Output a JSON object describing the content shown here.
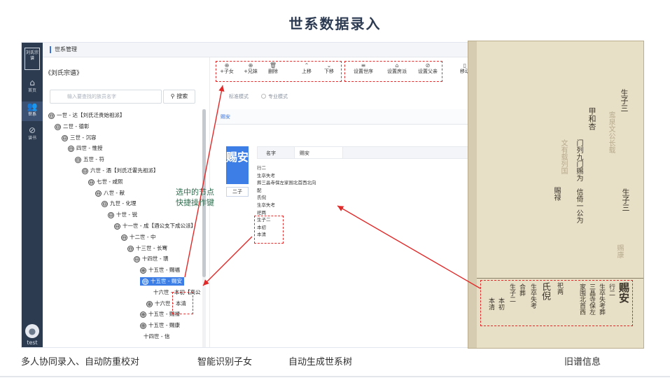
{
  "slide": {
    "title": "世系数据录入",
    "captions": [
      "多人协同录入、自动防重校对",
      "智能识别子女",
      "自动生成世系树",
      "旧谱信息"
    ]
  },
  "app": {
    "logo_text": "刘氏宗谱",
    "nav": [
      {
        "label": "首页",
        "icon": "home-icon"
      },
      {
        "label": "世系",
        "icon": "users-icon"
      },
      {
        "label": "谱书",
        "icon": "book-icon"
      }
    ],
    "user": "test",
    "topbar_title": "世系管理",
    "genealogy_name": "《刘氏宗谱》",
    "search": {
      "placeholder": "输入要查找的族员名字",
      "button": "搜索"
    },
    "tree": [
      {
        "label": "一世 - 达【刘氏迁贵始祖派】",
        "toggle": "⊖"
      },
      {
        "label": "二世 - 德彰",
        "toggle": "⊖"
      },
      {
        "label": "三世 - 沉容",
        "toggle": "⊖"
      },
      {
        "label": "四世 - 惟授",
        "toggle": "⊖"
      },
      {
        "label": "五世 - 符",
        "toggle": "⊖"
      },
      {
        "label": "六世 - 酒【刘氏迁霍先祖派】",
        "toggle": "⊖"
      },
      {
        "label": "七世 - 咸熙",
        "toggle": "⊖"
      },
      {
        "label": "八世 - 献",
        "toggle": "⊖"
      },
      {
        "label": "九世 - 化理",
        "toggle": "⊖"
      },
      {
        "label": "十世 - 锐",
        "toggle": "⊖"
      },
      {
        "label": "十一世 - 成【酒公支下成公派】",
        "toggle": "⊖"
      },
      {
        "label": "十二世 - 中",
        "toggle": "⊖"
      },
      {
        "label": "十三世 - 长骞",
        "toggle": "⊖"
      },
      {
        "label": "十四世 - 璜",
        "toggle": "⊖"
      },
      {
        "label": "十五世 - 赐福",
        "toggle": "⊕"
      },
      {
        "label": "十五世 - 赐安",
        "toggle": "⊖"
      },
      {
        "label": "十六世 - 本初【高公",
        "toggle": ""
      },
      {
        "label": "十六世 - 本清",
        "toggle": "⊕"
      },
      {
        "label": "十五世 - 赐禄",
        "toggle": "⊕"
      },
      {
        "label": "十五世 - 赐康",
        "toggle": "⊕"
      },
      {
        "label": "十四世 - 信",
        "toggle": ""
      }
    ],
    "toolbar": [
      {
        "label": "+子女",
        "icon": "plus-circle-icon"
      },
      {
        "label": "+兄妹",
        "icon": "plus-circle-icon"
      },
      {
        "label": "删除",
        "icon": "trash-icon"
      },
      {
        "label": "上移",
        "icon": "chevron-up-icon"
      },
      {
        "label": "下移",
        "icon": "chevron-down-icon"
      },
      {
        "label": "设置世序",
        "icon": "sort-icon"
      },
      {
        "label": "设置房派",
        "icon": "home-icon"
      },
      {
        "label": "设置父亲",
        "icon": "link-icon"
      },
      {
        "label": "移动",
        "icon": "move-icon"
      }
    ],
    "modes": [
      "标准模式",
      "专业模式"
    ],
    "subtab": "赐安",
    "person": {
      "card_name": "赐安",
      "child_label": "二子",
      "field_label": "名字",
      "field_value": "赐安",
      "text_lines": [
        "行二",
        "生卒失考",
        "葬三晶寺保左家围北首西北向",
        "配",
        "氏倪",
        "生卒失考",
        "祀两",
        "生子二",
        "本初",
        "本清"
      ]
    },
    "annotation": [
      "选中的节点",
      "快捷操作键"
    ]
  },
  "old_record": {
    "main_name": "赐安",
    "columns": [
      {
        "text": "生子三"
      },
      {
        "text": "甲和杏"
      },
      {
        "text": "鸾泉文公长载"
      },
      {
        "text": "门列九门赐为"
      },
      {
        "text": "文有载列国"
      },
      {
        "text": "生子三"
      },
      {
        "text": "信倚一公为"
      },
      {
        "text": "赐康"
      },
      {
        "text": "賜禄"
      },
      {
        "text": "行二"
      },
      {
        "text": "生卒失考葬"
      },
      {
        "text": "三晶寺保左"
      },
      {
        "text": "家围北首西"
      },
      {
        "text": "氏倪"
      },
      {
        "text": "生卒失考"
      },
      {
        "text": "祀两"
      },
      {
        "text": "生子二"
      },
      {
        "text": "本初"
      },
      {
        "text": "本清"
      },
      {
        "text": "合葬"
      }
    ]
  }
}
